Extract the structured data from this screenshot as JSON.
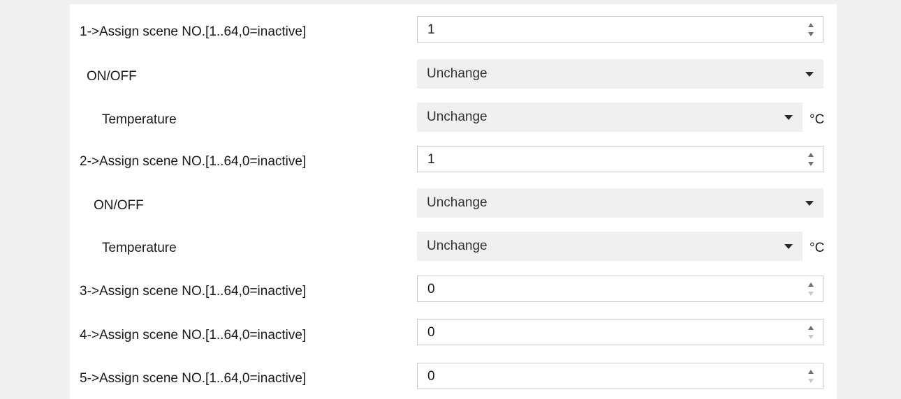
{
  "rows": [
    {
      "label": "1->Assign scene NO.[1..64,0=inactive]",
      "value": "1"
    },
    {
      "label": "ON/OFF",
      "value": "Unchange"
    },
    {
      "label": "Temperature",
      "value": "Unchange",
      "unit": "°C"
    },
    {
      "label": "2->Assign scene NO.[1..64,0=inactive]",
      "value": "1"
    },
    {
      "label": "ON/OFF",
      "value": "Unchange"
    },
    {
      "label": "Temperature",
      "value": "Unchange",
      "unit": "°C"
    },
    {
      "label": "3->Assign scene NO.[1..64,0=inactive]",
      "value": "0"
    },
    {
      "label": "4->Assign scene NO.[1..64,0=inactive]",
      "value": "0"
    },
    {
      "label": "5->Assign scene NO.[1..64,0=inactive]",
      "value": "0"
    }
  ],
  "icons": {
    "spin_up": "chevron-up-icon",
    "spin_down": "chevron-down-icon",
    "dropdown": "caret-down-icon"
  },
  "colors": {
    "background": "#f0f0f0",
    "panel": "#ffffff",
    "field_border": "#c9c9c9",
    "select_background": "#f0f0f0",
    "text": "#1a1a1a"
  }
}
